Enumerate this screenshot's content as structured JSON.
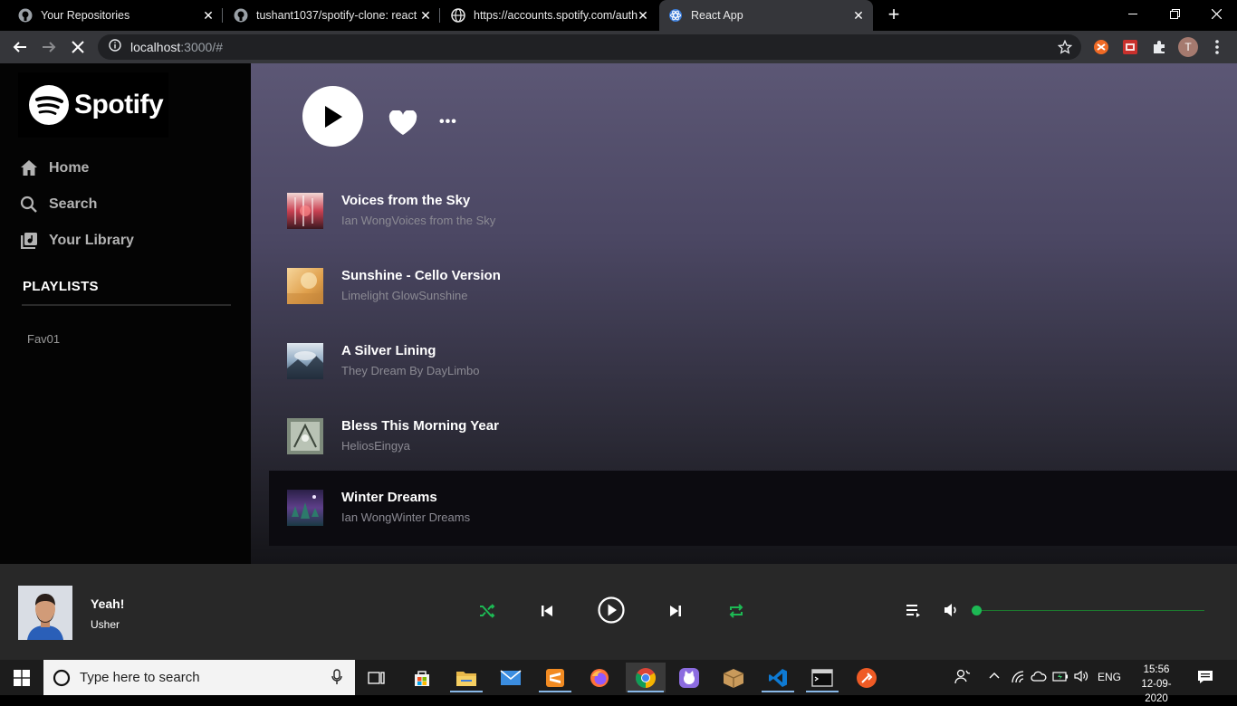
{
  "browser": {
    "tabs": [
      {
        "title": "Your Repositories",
        "favicon": "github-icon",
        "active": false
      },
      {
        "title": "tushant1037/spotify-clone: react",
        "favicon": "github-icon",
        "active": false
      },
      {
        "title": "https://accounts.spotify.com/auth",
        "favicon": "globe-icon",
        "active": false
      },
      {
        "title": "React App",
        "favicon": "react-icon",
        "active": true
      }
    ],
    "url_host": "localhost",
    "url_rest": ":3000/#",
    "profile_initial": "T"
  },
  "sidebar": {
    "logo_text": "Spotify",
    "nav": [
      {
        "label": "Home",
        "icon": "home-icon"
      },
      {
        "label": "Search",
        "icon": "search-icon"
      },
      {
        "label": "Your Library",
        "icon": "library-icon"
      }
    ],
    "playlists_title": "PLAYLISTS",
    "playlists": [
      "Fav01"
    ]
  },
  "tracks": [
    {
      "name": "Voices from the Sky",
      "artist": "Ian WongVoices from the Sky",
      "art_color": "#a23a4a"
    },
    {
      "name": "Sunshine - Cello Version",
      "artist": "Limelight GlowSunshine",
      "art_color": "#e3a752"
    },
    {
      "name": "A Silver Lining",
      "artist": "They Dream By DayLimbo",
      "art_color": "#8aa6c0"
    },
    {
      "name": "Bless This Morning Year",
      "artist": "HeliosEingya",
      "art_color": "#9ba79a"
    },
    {
      "name": "Winter Dreams",
      "artist": "Ian WongWinter Dreams",
      "art_color": "#4a3d66",
      "selected": true
    }
  ],
  "player": {
    "song": "Yeah!",
    "artist": "Usher",
    "volume": 0
  },
  "taskbar": {
    "search_placeholder": "Type here to search",
    "language": "ENG",
    "time": "15:56",
    "date": "12-09-2020"
  },
  "colors": {
    "accent_green": "#1db954",
    "player_bg": "#282828",
    "sidebar_bg": "#040404"
  }
}
